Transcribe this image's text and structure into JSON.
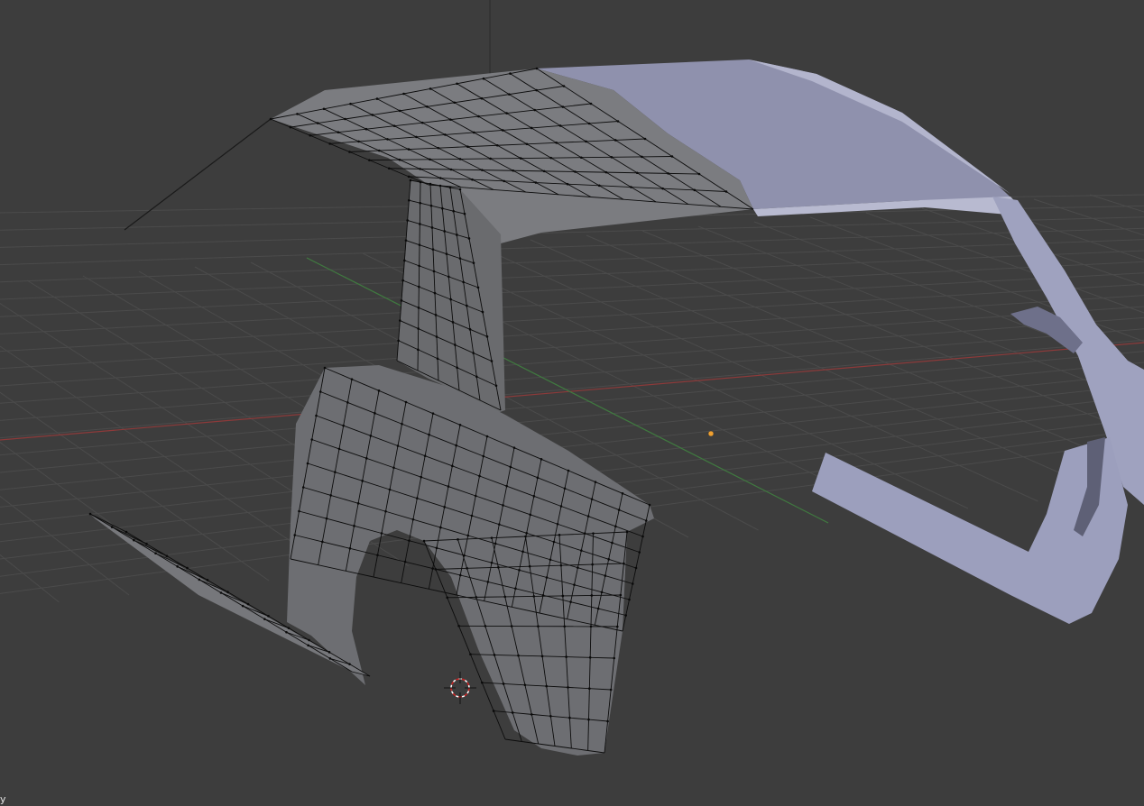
{
  "viewport": {
    "corner_label": "y",
    "colors": {
      "background": "#3d3d3d",
      "grid_line": "#4b4b4b",
      "x_axis": "#8c3a3a",
      "y_axis": "#3f7a3f",
      "edit_mesh_face": "#6f6f6f",
      "edit_mesh_wire": "#0c0c0c",
      "object_mode_mesh": "#a3a6c2",
      "origin_dot": "#f0a030",
      "cursor_ring": "#cc2222"
    }
  }
}
